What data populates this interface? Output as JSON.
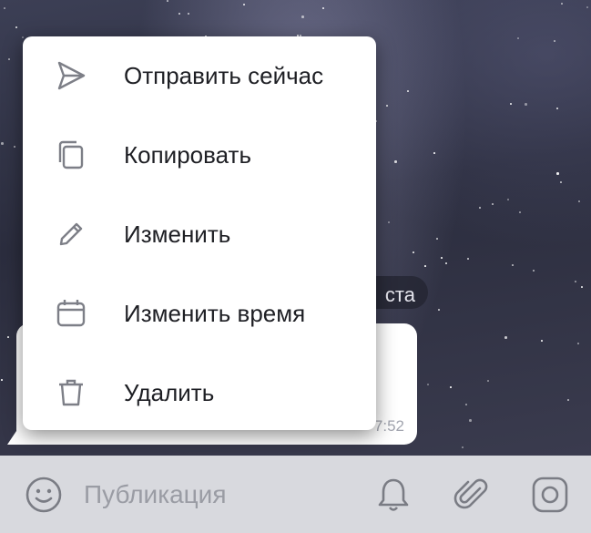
{
  "background": {
    "date_label_partial": "ста"
  },
  "message": {
    "time_partial": "7:52"
  },
  "context_menu": {
    "items": [
      {
        "label": "Отправить сейчас",
        "icon": "send-icon"
      },
      {
        "label": "Копировать",
        "icon": "copy-icon"
      },
      {
        "label": "Изменить",
        "icon": "pencil-icon"
      },
      {
        "label": "Изменить время",
        "icon": "calendar-icon"
      },
      {
        "label": "Удалить",
        "icon": "trash-icon"
      }
    ]
  },
  "input_bar": {
    "placeholder": "Публикация",
    "icons": [
      "emoji-icon",
      "bell-icon",
      "attach-icon",
      "camera-icon"
    ]
  },
  "colors": {
    "menu_bg": "#ffffff",
    "icon_gray": "#7d7f87",
    "bottom_bar": "#d8d9de"
  }
}
